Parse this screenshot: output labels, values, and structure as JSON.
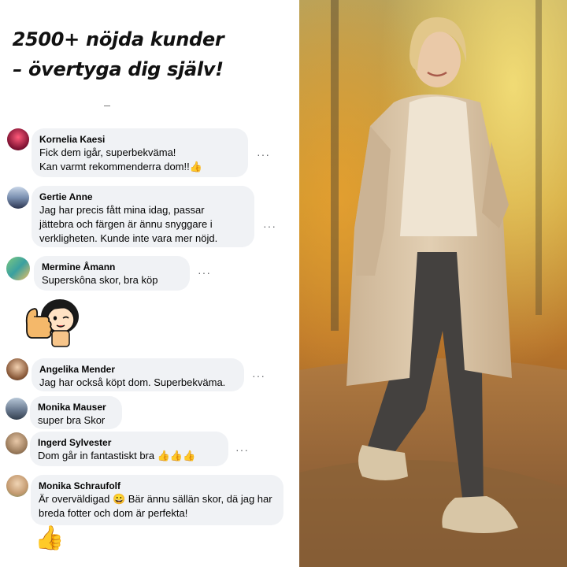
{
  "headline": {
    "line1": "2500+  nöjda kunder",
    "line2": "– övertyga dig själv!"
  },
  "comments": [
    {
      "name": "Kornelia Kaesi",
      "lines": [
        "Fick dem igår, superbekväma!",
        "Kan varmt rekommenderra dom!!👍"
      ],
      "more": "···"
    },
    {
      "name": "Gertie Anne",
      "lines": [
        "Jag har precis fått mina idag, passar",
        "jättebra och färgen är ännu snyggare i",
        "verkligheten. Kunde inte vara mer nöjd."
      ],
      "more": "···"
    },
    {
      "name": "Mermine Åmann",
      "lines": [
        "Superskôna skor, bra köp"
      ],
      "more": "···"
    },
    {
      "name": "Angelika Mender",
      "lines": [
        "Jag har också köpt dom. Superbekväma."
      ],
      "more": "···"
    },
    {
      "name": "Monika Mauser",
      "lines": [
        "super bra Skor"
      ]
    },
    {
      "name": "Ingerd Sylvester",
      "lines": [
        "Dom går in fantastiskt bra 👍👍👍"
      ],
      "more": "···"
    },
    {
      "name": "Monika Schraufolf",
      "lines": [
        "Är overväldigad 😀 Bär ännu sällän skor, dä jag har",
        "breda fotter och dom är perfekta!"
      ]
    }
  ],
  "sticker": {
    "icon": "thumbs-up-girl-sticker"
  },
  "bottom_emoji": {
    "icon": "thumbs-up-icon",
    "glyph": "👍"
  },
  "photo": {
    "subject": "woman-walking-autumn-park"
  },
  "colors": {
    "bubble": "#f0f2f5",
    "text": "#050505",
    "muted": "#65676b"
  }
}
